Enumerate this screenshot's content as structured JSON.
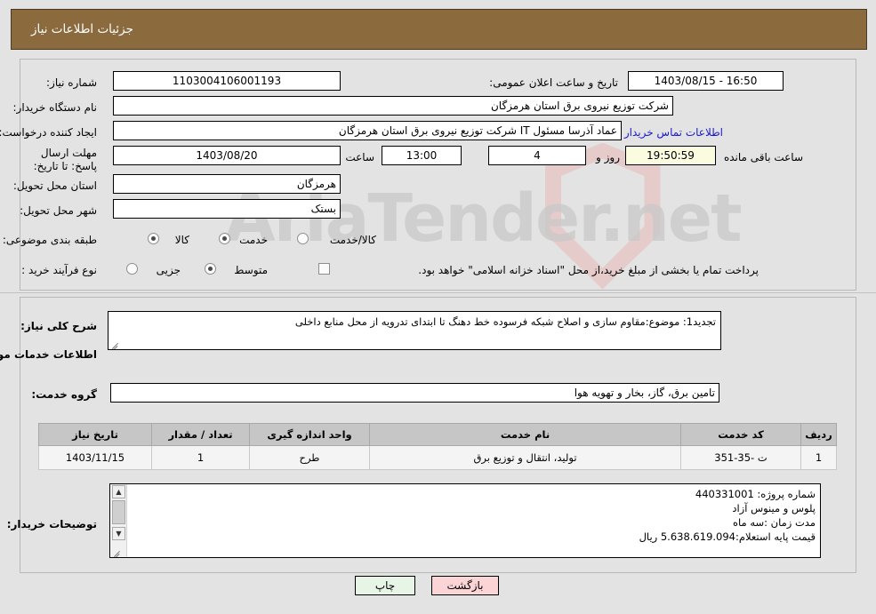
{
  "header": {
    "title": "جزئیات اطلاعات نیاز"
  },
  "watermark": {
    "text": "AriaTender.net"
  },
  "form": {
    "need_number_label": "شماره نیاز:",
    "need_number_value": "1103004106001193",
    "announce_label": "تاریخ و ساعت اعلان عمومی:",
    "announce_value": "1403/08/15 - 16:50",
    "buyer_org_label": "نام دستگاه خریدار:",
    "buyer_org_value": "شرکت توزیع نیروی برق استان هرمزگان",
    "creator_label": "ایجاد کننده درخواست:",
    "creator_value": "عماد آذرسا مسئول IT شرکت توزیع نیروی برق استان هرمزگان",
    "contact_link": "اطلاعات تماس خریدار",
    "deadline_label": "مهلت ارسال پاسخ: تا تاریخ:",
    "deadline_date": "1403/08/20",
    "deadline_hour_label": "ساعت",
    "deadline_hour": "13:00",
    "remain_days": "4",
    "remain_days_label": "روز و",
    "remain_clock": "19:50:59",
    "remain_clock_label": "ساعت باقی مانده",
    "province_label": "استان محل تحویل:",
    "province_value": "هرمزگان",
    "city_label": "شهر محل تحویل:",
    "city_value": "بستک",
    "category_label": "طبقه بندی موضوعی:",
    "category_options": [
      {
        "label": "کالا",
        "selected": false
      },
      {
        "label": "خدمت",
        "selected": true
      },
      {
        "label": "کالا/خدمت",
        "selected": false
      }
    ],
    "process_label": "نوع فرآیند خرید :",
    "process_options": [
      {
        "label": "جزیی",
        "selected": false
      },
      {
        "label": "متوسط",
        "selected": true
      }
    ],
    "treasury_checkbox_checked": false,
    "treasury_note": "پرداخت تمام یا بخشی از مبلغ خرید،از محل \"اسناد خزانه اسلامی\" خواهد بود."
  },
  "description": {
    "need_summary_label": "شرح کلی نیاز:",
    "need_summary_value": "تجدید1: موضوع:مقاوم سازی و اصلاح شبکه فرسوده خط دهنگ تا ابتدای تدرویه از محل منابع داخلی",
    "services_heading": "اطلاعات خدمات مورد نیاز",
    "service_group_label": "گروه خدمت:",
    "service_group_value": "تامین برق، گاز، بخار و تهویه هوا"
  },
  "table": {
    "columns": [
      "ردیف",
      "کد خدمت",
      "نام خدمت",
      "واحد اندازه گیری",
      "تعداد / مقدار",
      "تاریخ نیاز"
    ],
    "rows": [
      [
        "1",
        "ت -35-351",
        "تولید، انتقال و توزیع برق",
        "طرح",
        "1",
        "1403/11/15"
      ]
    ]
  },
  "notes": {
    "label": "توضیحات خریدار:",
    "lines": [
      "شماره پروژه:  440331001",
      "پلوس و مینوس آزاد",
      "مدت زمان :سه ماه",
      "قیمت پایه استعلام:5.638.619.094 ریال"
    ]
  },
  "buttons": {
    "print": "چاپ",
    "back": "بازگشت"
  },
  "icons": {
    "scroll_up": "▲",
    "scroll_down": "▼"
  }
}
